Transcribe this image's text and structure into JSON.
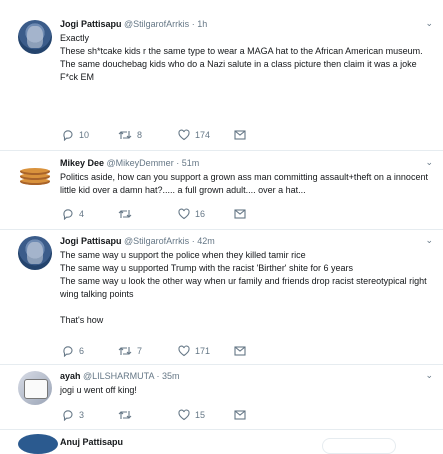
{
  "tweets": [
    {
      "name": "Jogi Pattisapu",
      "handle": "@StilgarofArrkis",
      "time": "· 1h",
      "lines": [
        "Exactly",
        "These sh*tcake kids r the same type to wear a MAGA hat to the African American museum.",
        "The same douchebag kids who do a Nazi salute in a class picture then claim it was a joke",
        "F*ck EM"
      ],
      "replies": "10",
      "retweets": "8",
      "likes": "174"
    },
    {
      "name": "Mikey Dee",
      "handle": "@MikeyDemmer",
      "time": "· 51m",
      "lines": [
        "Politics aside, how can you support a grown ass man committing assault+theft on a innocent little kid over a damn hat?..... a full grown adult.... over a hat..."
      ],
      "replies": "4",
      "retweets": "",
      "likes": "16"
    },
    {
      "name": "Jogi Pattisapu",
      "handle": "@StilgarofArrkis",
      "time": "· 42m",
      "lines": [
        "The same way u support the police when they killed tamir rice",
        "The same way u supported Trump with the racist 'Birther' shite for 6 years",
        "The same way u look the other way when ur family and friends drop racist stereotypical right wing talking points",
        "",
        "That's how"
      ],
      "replies": "6",
      "retweets": "7",
      "likes": "171"
    },
    {
      "name": "ayah",
      "handle": "@LILSHARMUTA",
      "time": "· 35m",
      "lines": [
        "jogi u went off king!"
      ],
      "replies": "3",
      "retweets": "",
      "likes": "15"
    }
  ],
  "next_tweet": {
    "name": "Anuj Pattisapu"
  },
  "icons": {
    "reply": "reply-icon",
    "retweet": "retweet-icon",
    "like": "heart-icon",
    "dm": "envelope-icon",
    "menu": "chevron-down-icon"
  }
}
